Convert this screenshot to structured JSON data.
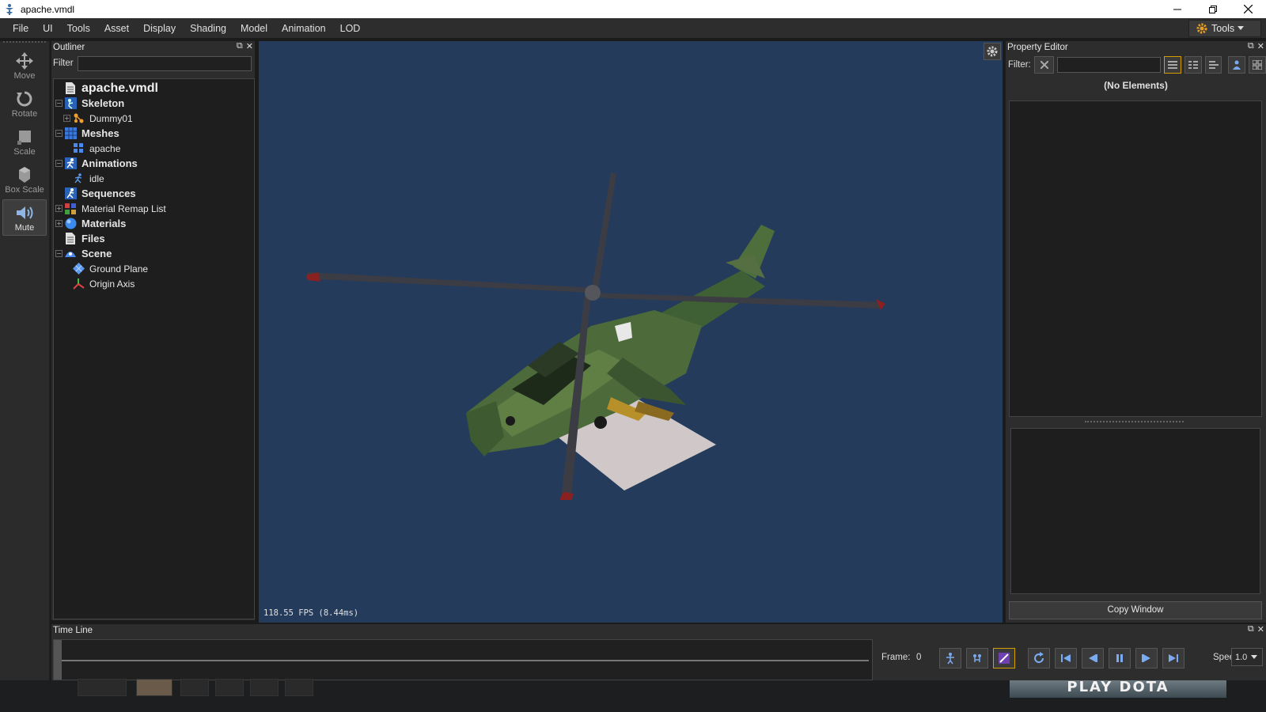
{
  "window": {
    "title": "apache.vmdl"
  },
  "menu": [
    "File",
    "UI",
    "Tools",
    "Asset",
    "Display",
    "Shading",
    "Model",
    "Animation",
    "LOD"
  ],
  "tools_button": {
    "label": "Tools"
  },
  "toolbar": [
    {
      "label": "Move",
      "icon": "move-icon"
    },
    {
      "label": "Rotate",
      "icon": "rotate-icon"
    },
    {
      "label": "Scale",
      "icon": "scale-icon"
    },
    {
      "label": "Box Scale",
      "icon": "box-scale-icon"
    },
    {
      "label": "Mute",
      "icon": "speaker-icon"
    }
  ],
  "outliner": {
    "title": "Outliner",
    "filter_label": "Filter",
    "root": "apache.vmdl",
    "items": [
      {
        "label": "Skeleton",
        "style": "bold"
      },
      {
        "label": "Dummy01",
        "style": "norm"
      },
      {
        "label": "Meshes",
        "style": "bold"
      },
      {
        "label": "apache",
        "style": "norm"
      },
      {
        "label": "Animations",
        "style": "bold"
      },
      {
        "label": "idle",
        "style": "norm"
      },
      {
        "label": "Sequences",
        "style": "bold"
      },
      {
        "label": "Material Remap List",
        "style": "norm"
      },
      {
        "label": "Materials",
        "style": "bold"
      },
      {
        "label": "Files",
        "style": "bold"
      },
      {
        "label": "Scene",
        "style": "bold"
      },
      {
        "label": "Ground Plane",
        "style": "norm"
      },
      {
        "label": "Origin Axis",
        "style": "norm"
      }
    ]
  },
  "viewport": {
    "fps": "118.55 FPS (8.44ms)"
  },
  "property_editor": {
    "title": "Property Editor",
    "filter_label": "Filter:",
    "empty_text": "(No Elements)",
    "copy_button": "Copy Window"
  },
  "timeline": {
    "title": "Time Line",
    "frame_label": "Frame:",
    "frame_value": "0",
    "speed_label": "Speed",
    "speed_value": "1.0"
  },
  "background": {
    "banner_text": "PLAY DOTA"
  },
  "colors": {
    "viewport_bg": "#253b5b",
    "panel_bg": "#2d2d2d",
    "accent": "#d4a000"
  }
}
